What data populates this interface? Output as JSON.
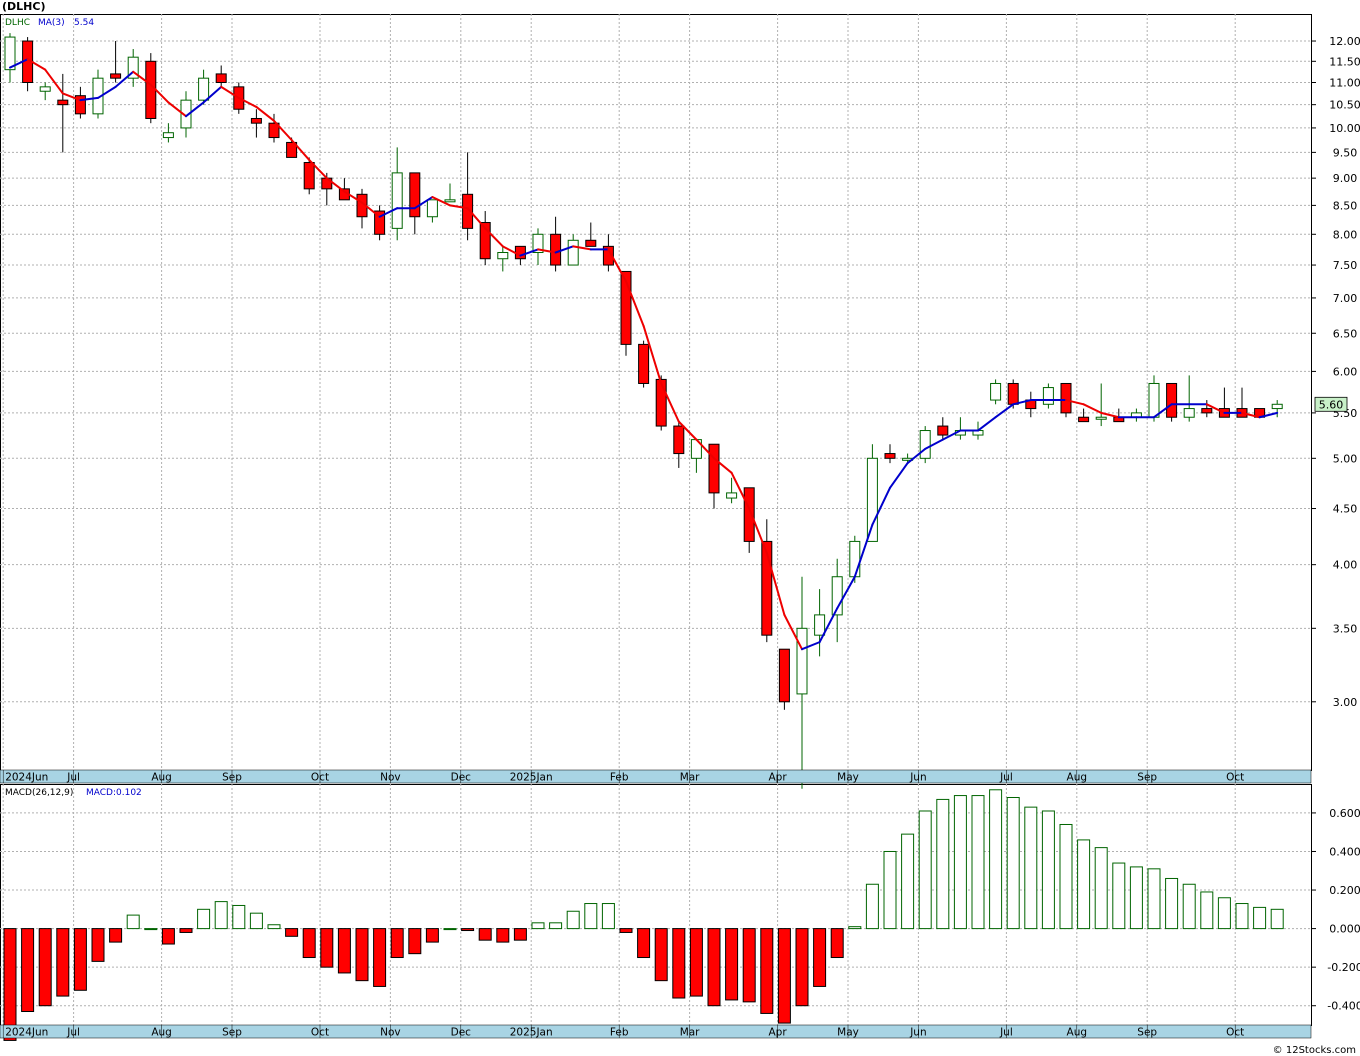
{
  "title": "(DLHC)",
  "credit": "© 12Stocks.com",
  "colors": {
    "up_candle": "#006400",
    "down_candle": "#ff0000",
    "ma_up": "#0000cc",
    "ma_down": "#ee0000",
    "hist_pos": "#006400",
    "hist_neg": "#ff0000",
    "grid": "#b0b0b0",
    "axis_strip": "#a8d4e4",
    "price_tag_bg": "#c8f0c8"
  },
  "price_panel": {
    "symbol_label": "DLHC",
    "ma_label": "MA(3)",
    "ma_value": "5.54",
    "last_price": "5.60",
    "scale": "log",
    "ylim": [
      2.6,
      12.7
    ],
    "y_ticks": [
      "12.00",
      "11.50",
      "11.00",
      "10.50",
      "10.00",
      "9.50",
      "9.00",
      "8.50",
      "8.00",
      "7.50",
      "7.00",
      "6.50",
      "6.00",
      "5.50",
      "5.00",
      "4.50",
      "4.00",
      "3.50",
      "3.00"
    ],
    "month_labels": [
      "2024Jun",
      "Jul",
      "Aug",
      "Sep",
      "Oct",
      "Nov",
      "Dec",
      "2025Jan",
      "Feb",
      "Mar",
      "Apr",
      "May",
      "Jun",
      "Jul",
      "Aug",
      "Sep",
      "Oct"
    ]
  },
  "macd_panel": {
    "label": "MACD(26,12,9)",
    "value_label": "MACD:0.102",
    "ylim": [
      -0.5,
      0.75
    ],
    "y_ticks": [
      "0.600",
      "0.400",
      "0.200",
      "0.000",
      "-0.200",
      "-0.400"
    ]
  },
  "chart_data": {
    "type": "candlestick",
    "interval": "weekly",
    "month_start_week": [
      0,
      4,
      9,
      13,
      18,
      22,
      26,
      30,
      35,
      39,
      44,
      48,
      52,
      57,
      61,
      65,
      70
    ],
    "candles": [
      {
        "o": 11.3,
        "h": 12.2,
        "l": 11.0,
        "c": 12.1
      },
      {
        "o": 12.0,
        "h": 12.1,
        "l": 10.8,
        "c": 11.0
      },
      {
        "o": 10.8,
        "h": 11.0,
        "l": 10.6,
        "c": 10.9
      },
      {
        "o": 10.6,
        "h": 11.2,
        "l": 9.5,
        "c": 10.5
      },
      {
        "o": 10.7,
        "h": 10.9,
        "l": 10.2,
        "c": 10.3
      },
      {
        "o": 10.3,
        "h": 11.3,
        "l": 10.2,
        "c": 11.1
      },
      {
        "o": 11.2,
        "h": 12.0,
        "l": 11.0,
        "c": 11.1
      },
      {
        "o": 11.1,
        "h": 11.8,
        "l": 10.9,
        "c": 11.6
      },
      {
        "o": 11.5,
        "h": 11.7,
        "l": 10.1,
        "c": 10.2
      },
      {
        "o": 9.8,
        "h": 10.1,
        "l": 9.7,
        "c": 9.9
      },
      {
        "o": 10.0,
        "h": 10.8,
        "l": 9.8,
        "c": 10.6
      },
      {
        "o": 10.6,
        "h": 11.3,
        "l": 10.5,
        "c": 11.1
      },
      {
        "o": 11.2,
        "h": 11.4,
        "l": 10.9,
        "c": 11.0
      },
      {
        "o": 10.9,
        "h": 11.0,
        "l": 10.3,
        "c": 10.4
      },
      {
        "o": 10.2,
        "h": 10.4,
        "l": 9.8,
        "c": 10.1
      },
      {
        "o": 10.1,
        "h": 10.3,
        "l": 9.7,
        "c": 9.8
      },
      {
        "o": 9.7,
        "h": 9.8,
        "l": 9.4,
        "c": 9.4
      },
      {
        "o": 9.3,
        "h": 9.4,
        "l": 8.7,
        "c": 8.8
      },
      {
        "o": 9.0,
        "h": 9.1,
        "l": 8.5,
        "c": 8.8
      },
      {
        "o": 8.8,
        "h": 9.0,
        "l": 8.6,
        "c": 8.6
      },
      {
        "o": 8.7,
        "h": 8.8,
        "l": 8.1,
        "c": 8.3
      },
      {
        "o": 8.4,
        "h": 8.5,
        "l": 7.9,
        "c": 8.0
      },
      {
        "o": 8.1,
        "h": 9.6,
        "l": 7.9,
        "c": 9.1
      },
      {
        "o": 9.1,
        "h": 9.1,
        "l": 8.0,
        "c": 8.3
      },
      {
        "o": 8.3,
        "h": 8.6,
        "l": 8.2,
        "c": 8.6
      },
      {
        "o": 8.6,
        "h": 8.9,
        "l": 8.6,
        "c": 8.6
      },
      {
        "o": 8.7,
        "h": 9.5,
        "l": 7.9,
        "c": 8.1
      },
      {
        "o": 8.2,
        "h": 8.4,
        "l": 7.5,
        "c": 7.6
      },
      {
        "o": 7.6,
        "h": 7.8,
        "l": 7.4,
        "c": 7.7
      },
      {
        "o": 7.8,
        "h": 7.8,
        "l": 7.5,
        "c": 7.6
      },
      {
        "o": 7.7,
        "h": 8.1,
        "l": 7.5,
        "c": 8.0
      },
      {
        "o": 8.0,
        "h": 8.3,
        "l": 7.4,
        "c": 7.5
      },
      {
        "o": 7.5,
        "h": 8.0,
        "l": 7.5,
        "c": 7.9
      },
      {
        "o": 7.9,
        "h": 8.2,
        "l": 7.8,
        "c": 7.8
      },
      {
        "o": 7.8,
        "h": 8.0,
        "l": 7.4,
        "c": 7.5
      },
      {
        "o": 7.4,
        "h": 7.4,
        "l": 6.2,
        "c": 6.35
      },
      {
        "o": 6.35,
        "h": 6.4,
        "l": 5.8,
        "c": 5.85
      },
      {
        "o": 5.9,
        "h": 5.95,
        "l": 5.3,
        "c": 5.35
      },
      {
        "o": 5.35,
        "h": 5.4,
        "l": 4.9,
        "c": 5.05
      },
      {
        "o": 5.0,
        "h": 5.2,
        "l": 4.85,
        "c": 5.2
      },
      {
        "o": 5.15,
        "h": 5.15,
        "l": 4.5,
        "c": 4.65
      },
      {
        "o": 4.6,
        "h": 4.8,
        "l": 4.55,
        "c": 4.65
      },
      {
        "o": 4.7,
        "h": 4.7,
        "l": 4.1,
        "c": 4.2
      },
      {
        "o": 4.2,
        "h": 4.4,
        "l": 3.4,
        "c": 3.45
      },
      {
        "o": 3.35,
        "h": 3.35,
        "l": 2.95,
        "c": 3.0
      },
      {
        "o": 3.05,
        "h": 3.9,
        "l": 2.5,
        "c": 3.5
      },
      {
        "o": 3.45,
        "h": 3.8,
        "l": 3.3,
        "c": 3.6
      },
      {
        "o": 3.6,
        "h": 4.05,
        "l": 3.4,
        "c": 3.9
      },
      {
        "o": 3.9,
        "h": 4.25,
        "l": 3.85,
        "c": 4.2
      },
      {
        "o": 4.2,
        "h": 5.15,
        "l": 4.2,
        "c": 5.0
      },
      {
        "o": 5.05,
        "h": 5.15,
        "l": 4.95,
        "c": 5.0
      },
      {
        "o": 5.0,
        "h": 5.05,
        "l": 4.95,
        "c": 5.0
      },
      {
        "o": 5.0,
        "h": 5.35,
        "l": 4.95,
        "c": 5.3
      },
      {
        "o": 5.35,
        "h": 5.45,
        "l": 5.2,
        "c": 5.25
      },
      {
        "o": 5.25,
        "h": 5.45,
        "l": 5.2,
        "c": 5.3
      },
      {
        "o": 5.25,
        "h": 5.4,
        "l": 5.2,
        "c": 5.3
      },
      {
        "o": 5.65,
        "h": 5.9,
        "l": 5.6,
        "c": 5.85
      },
      {
        "o": 5.85,
        "h": 5.9,
        "l": 5.55,
        "c": 5.6
      },
      {
        "o": 5.65,
        "h": 5.75,
        "l": 5.45,
        "c": 5.55
      },
      {
        "o": 5.6,
        "h": 5.85,
        "l": 5.55,
        "c": 5.8
      },
      {
        "o": 5.85,
        "h": 5.85,
        "l": 5.45,
        "c": 5.5
      },
      {
        "o": 5.45,
        "h": 5.55,
        "l": 5.4,
        "c": 5.4
      },
      {
        "o": 5.45,
        "h": 5.85,
        "l": 5.35,
        "c": 5.45
      },
      {
        "o": 5.45,
        "h": 5.55,
        "l": 5.4,
        "c": 5.4
      },
      {
        "o": 5.45,
        "h": 5.55,
        "l": 5.4,
        "c": 5.5
      },
      {
        "o": 5.45,
        "h": 5.95,
        "l": 5.4,
        "c": 5.85
      },
      {
        "o": 5.85,
        "h": 5.85,
        "l": 5.4,
        "c": 5.45
      },
      {
        "o": 5.45,
        "h": 5.95,
        "l": 5.4,
        "c": 5.55
      },
      {
        "o": 5.55,
        "h": 5.65,
        "l": 5.45,
        "c": 5.5
      },
      {
        "o": 5.55,
        "h": 5.8,
        "l": 5.45,
        "c": 5.45
      },
      {
        "o": 5.55,
        "h": 5.8,
        "l": 5.45,
        "c": 5.45
      },
      {
        "o": 5.55,
        "h": 5.55,
        "l": 5.45,
        "c": 5.45
      },
      {
        "o": 5.55,
        "h": 5.65,
        "l": 5.45,
        "c": 5.6
      }
    ],
    "ma3": [
      11.35,
      11.55,
      11.3,
      10.75,
      10.6,
      10.65,
      10.9,
      11.25,
      10.95,
      10.55,
      10.25,
      10.55,
      10.9,
      10.65,
      10.45,
      10.15,
      9.75,
      9.35,
      9.0,
      8.75,
      8.55,
      8.3,
      8.45,
      8.45,
      8.65,
      8.5,
      8.45,
      8.1,
      7.8,
      7.65,
      7.75,
      7.7,
      7.8,
      7.75,
      7.75,
      7.25,
      6.6,
      5.85,
      5.4,
      5.2,
      5.0,
      4.85,
      4.5,
      4.1,
      3.6,
      3.35,
      3.4,
      3.65,
      3.9,
      4.35,
      4.7,
      4.95,
      5.1,
      5.2,
      5.3,
      5.3,
      5.45,
      5.6,
      5.65,
      5.65,
      5.65,
      5.6,
      5.5,
      5.45,
      5.45,
      5.45,
      5.6,
      5.6,
      5.6,
      5.5,
      5.5,
      5.45,
      5.5
    ],
    "macd_hist": [
      -0.58,
      -0.43,
      -0.4,
      -0.35,
      -0.32,
      -0.17,
      -0.07,
      0.07,
      0.0,
      -0.08,
      -0.02,
      0.1,
      0.14,
      0.12,
      0.08,
      0.02,
      -0.04,
      -0.15,
      -0.2,
      -0.23,
      -0.27,
      -0.3,
      -0.15,
      -0.13,
      -0.07,
      0.0,
      -0.01,
      -0.06,
      -0.07,
      -0.06,
      0.03,
      0.03,
      0.09,
      0.13,
      0.13,
      -0.02,
      -0.15,
      -0.27,
      -0.36,
      -0.35,
      -0.4,
      -0.37,
      -0.38,
      -0.44,
      -0.49,
      -0.4,
      -0.3,
      -0.15,
      0.01,
      0.23,
      0.4,
      0.49,
      0.61,
      0.67,
      0.69,
      0.69,
      0.72,
      0.68,
      0.63,
      0.61,
      0.54,
      0.46,
      0.42,
      0.34,
      0.32,
      0.31,
      0.26,
      0.23,
      0.19,
      0.16,
      0.13,
      0.11,
      0.1
    ]
  }
}
